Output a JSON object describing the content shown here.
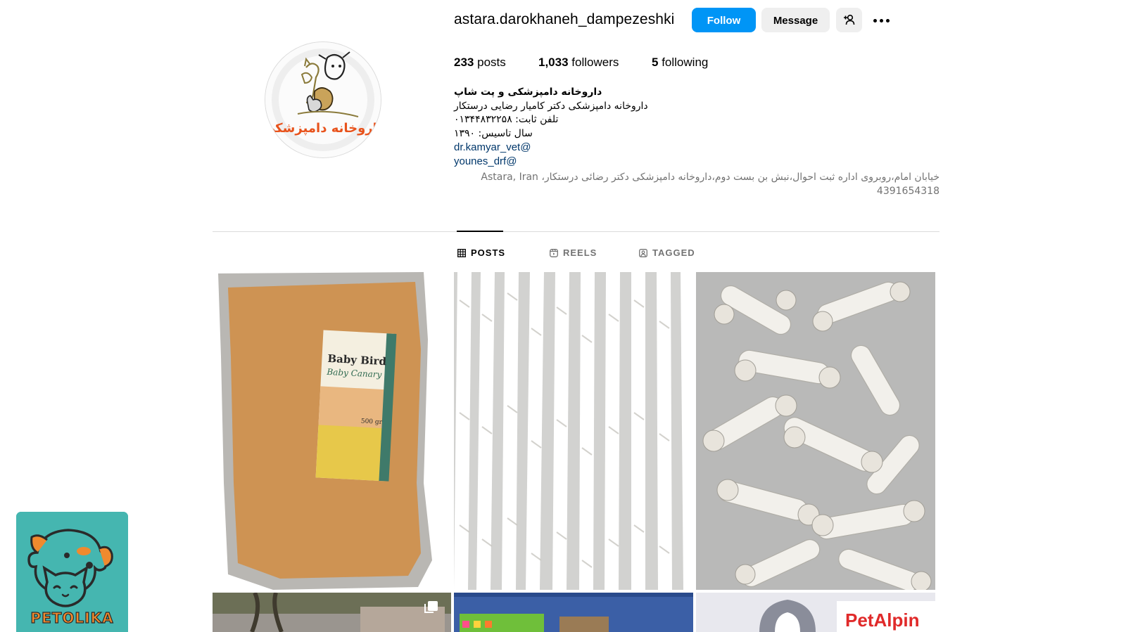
{
  "profile": {
    "username": "astara.darokhaneh_dampezeshki",
    "avatar_text": "داروخانه دامپزشکی",
    "follow_label": "Follow",
    "message_label": "Message",
    "add_user_icon": "add-user-icon",
    "more_icon": "more-options-icon"
  },
  "stats": {
    "posts_count": "233",
    "posts_label": "posts",
    "followers_count": "1,033",
    "followers_label": "followers",
    "following_count": "5",
    "following_label": "following"
  },
  "bio": {
    "name": "داروخانه دامپزشکی و پت شاپ",
    "line1": "داروخانه دامپزشکی دکتر کامیار رضایی درستکار",
    "line2": "تلفن ثابت: ۰۱۳۴۴۸۳۲۲۵۸",
    "line3": "سال تاسیس: ۱۳۹۰",
    "link1": "dr.kamyar_vet@",
    "link2": "younes_drf@",
    "address_line1": "خیابان امام،روبروی اداره ثبت احوال،نبش بن بست دوم،داروخانه دامپزشکی دکتر رضائی درستکار، Astara, Iran",
    "address_line2": "4391654318"
  },
  "tabs": [
    {
      "label": "POSTS",
      "icon": "grid-icon",
      "active": true
    },
    {
      "label": "REELS",
      "icon": "reels-icon",
      "active": false
    },
    {
      "label": "TAGGED",
      "icon": "tagged-icon",
      "active": false
    }
  ],
  "posts": [
    {
      "description_label_title": "Baby Bird",
      "description_label_sub": "Baby Canary",
      "weight": "500 gr"
    },
    {},
    {},
    {},
    {},
    {
      "brand": "PetAlpin"
    }
  ],
  "badge": {
    "label": "PETOLIKA"
  },
  "colors": {
    "primary_button": "#0095f6",
    "secondary_button": "#efefef",
    "link": "#00376b",
    "muted_text": "#737373",
    "divider": "#dbdbdb",
    "badge_bg": "#45b6b0",
    "avatar_text": "#e8531c"
  }
}
